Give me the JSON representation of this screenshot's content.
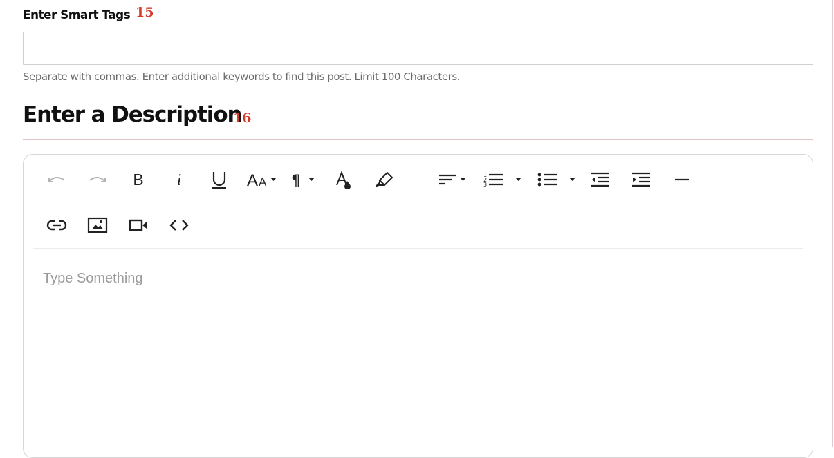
{
  "smart_tags": {
    "label": "Enter Smart Tags",
    "marker": "15",
    "value": "",
    "helper": "Separate with commas. Enter additional keywords to find this post. Limit 100 Characters."
  },
  "description": {
    "title": "Enter a Description",
    "marker": "16",
    "placeholder": "Type Something"
  },
  "toolbar": {
    "row1": [
      "undo-icon",
      "redo-icon",
      "bold-icon",
      "italic-icon",
      "underline-icon",
      "font-size-icon",
      "paragraph-format-icon",
      "text-color-icon",
      "highlight-icon",
      "align-icon",
      "ordered-list-icon",
      "unordered-list-icon",
      "outdent-icon",
      "indent-icon",
      "horizontal-line-icon"
    ],
    "row2": [
      "link-icon",
      "image-icon",
      "video-icon",
      "code-view-icon"
    ]
  }
}
